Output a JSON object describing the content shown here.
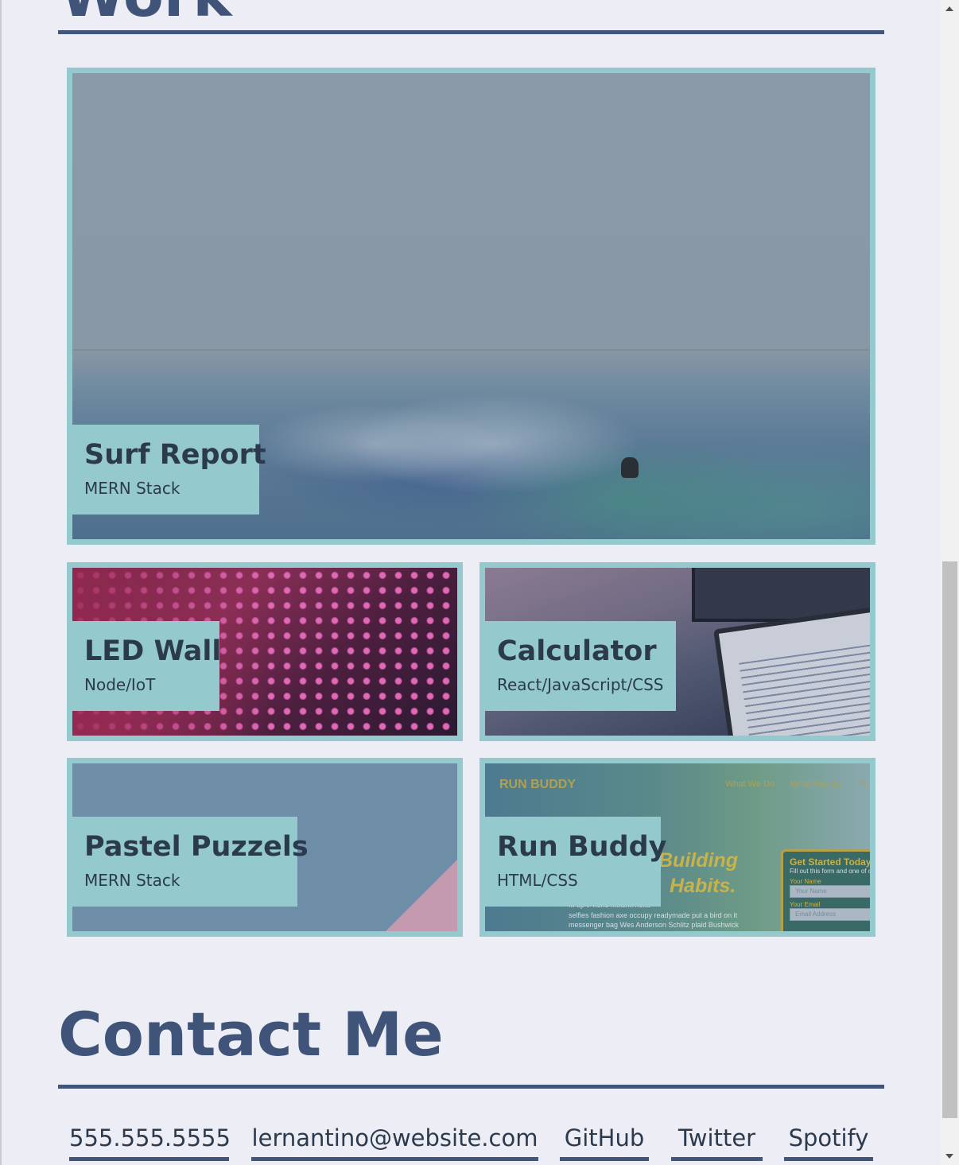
{
  "work": {
    "heading": "Work"
  },
  "projects": [
    {
      "title": "Surf Report",
      "subtitle": "MERN Stack"
    },
    {
      "title": "LED Wall",
      "subtitle": "Node/IoT"
    },
    {
      "title": "Calculator",
      "subtitle": "React/JavaScript/CSS"
    },
    {
      "title": "Pastel Puzzels",
      "subtitle": "MERN Stack"
    },
    {
      "title": "Run Buddy",
      "subtitle": "HTML/CSS",
      "preview": {
        "brand": "RUN BUDDY",
        "nav": [
          "What We Do",
          "What You Do",
          "Yo"
        ],
        "hero_line1": "Building",
        "hero_line2": "Habits.",
        "body_lines": [
          "... up iPhone mlkshk hella",
          "selfies fashion axe occupy readymade put a bird on it",
          "messenger bag Wes Anderson Schlitz plaid Bushwick"
        ],
        "form_title": "Get Started Today",
        "form_sub": "Fill out this form and one of o",
        "name_label": "Your Name",
        "name_placeholder": "Your Name",
        "email_label": "Your Email",
        "email_placeholder": "Email Address"
      }
    }
  ],
  "contact": {
    "heading": "Contact Me",
    "links": [
      "555.555.5555",
      "lernantino@website.com",
      "GitHub",
      "Twitter",
      "Spotify"
    ]
  },
  "colors": {
    "background": "#ecedf5",
    "heading": "#3f5478",
    "accent_border": "#94cacd",
    "text_dark": "#2c3a4e"
  }
}
